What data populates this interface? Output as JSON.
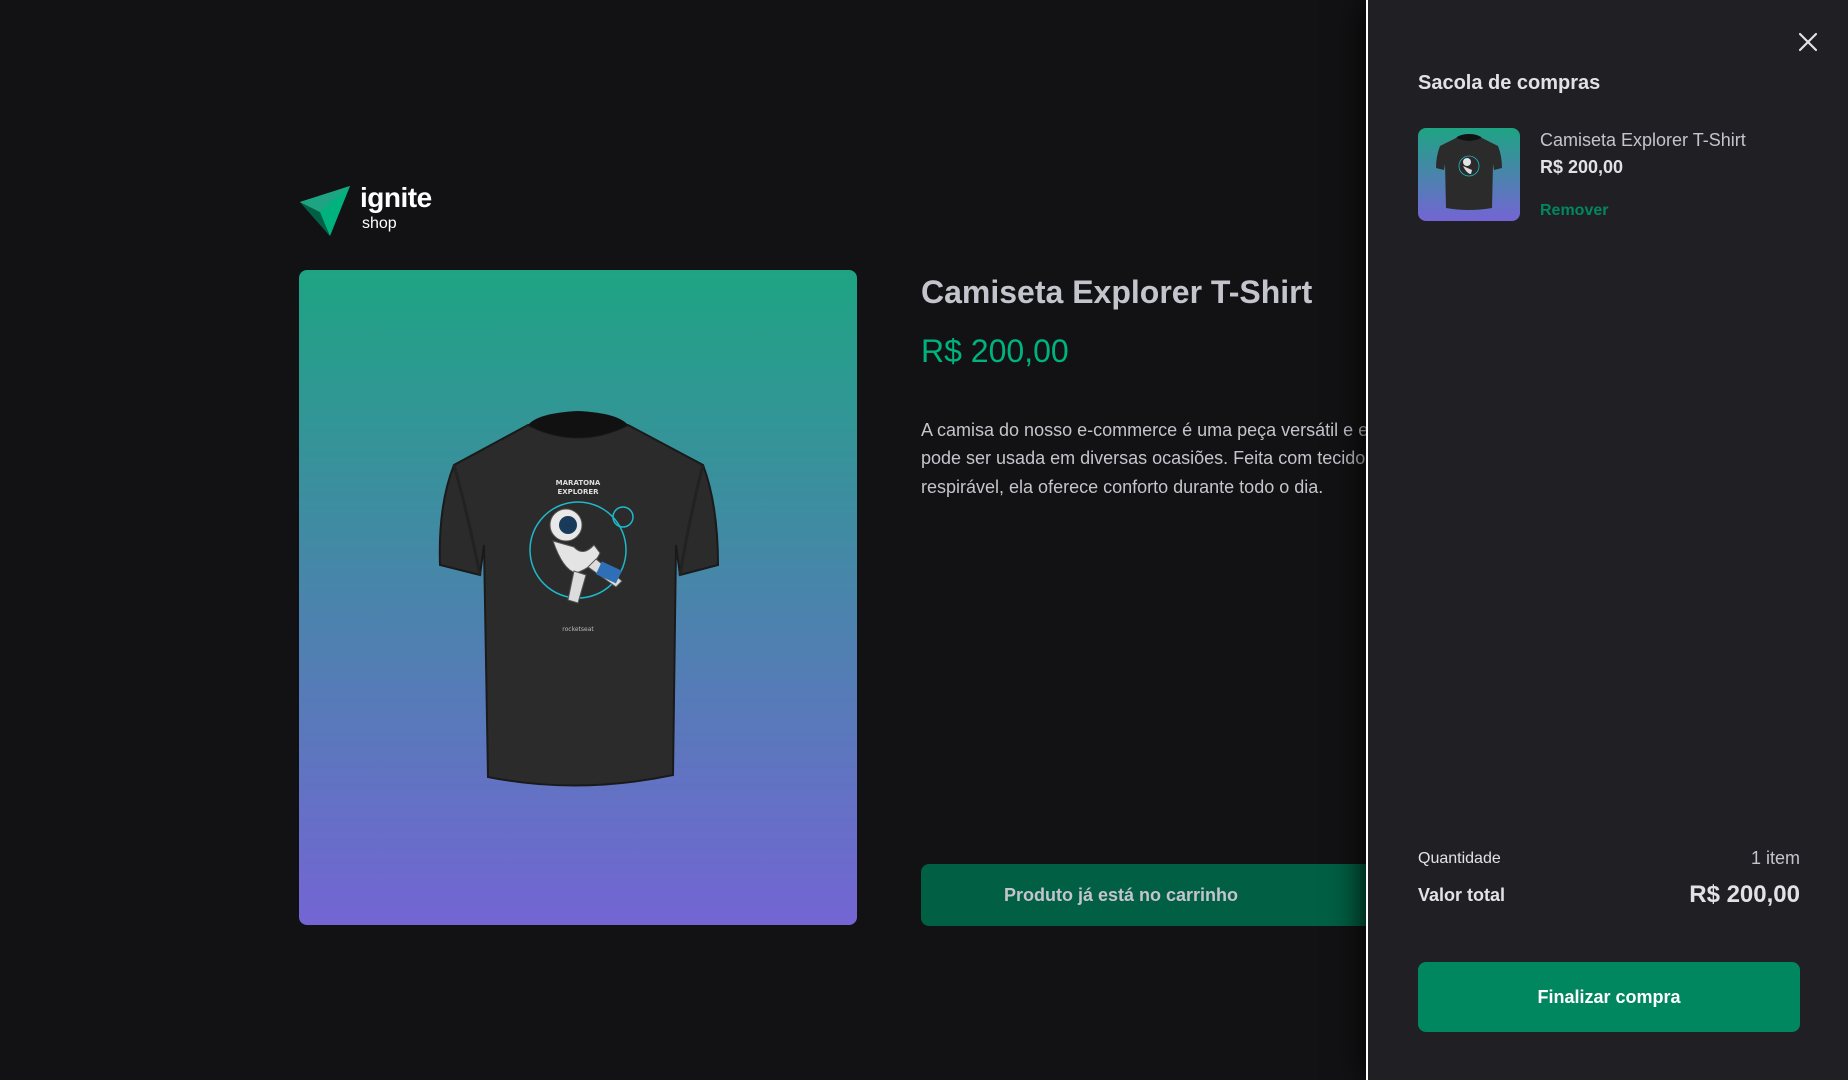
{
  "logo": {
    "title": "ignite",
    "subtitle": "shop"
  },
  "product": {
    "title": "Camiseta Explorer T-Shirt",
    "price": "R$ 200,00",
    "description_lines": [
      "A camisa do nosso e-commerce é uma peça versátil e e",
      "pode ser usada em diversas ocasiões. Feita com tecido",
      "respirável, ela oferece conforto durante todo o dia."
    ],
    "button_label": "Produto já está no carrinho",
    "image_icon": "t-shirt-astronaut-icon"
  },
  "cart": {
    "title": "Sacola de compras",
    "close_icon": "close-icon",
    "items": [
      {
        "name": "Camiseta Explorer T-Shirt",
        "price": "R$ 200,00",
        "remove_label": "Remover"
      }
    ],
    "quantity_label": "Quantidade",
    "quantity_value": "1 item",
    "total_label": "Valor total",
    "total_value": "R$ 200,00",
    "checkout_label": "Finalizar compra"
  },
  "colors": {
    "background": "#121214",
    "drawer": "#202024",
    "brand_green": "#00875f",
    "price_green": "#00b37e",
    "disabled_green": "#015f43",
    "gradient_top": "#1ea483",
    "gradient_bottom": "#7465d4"
  }
}
